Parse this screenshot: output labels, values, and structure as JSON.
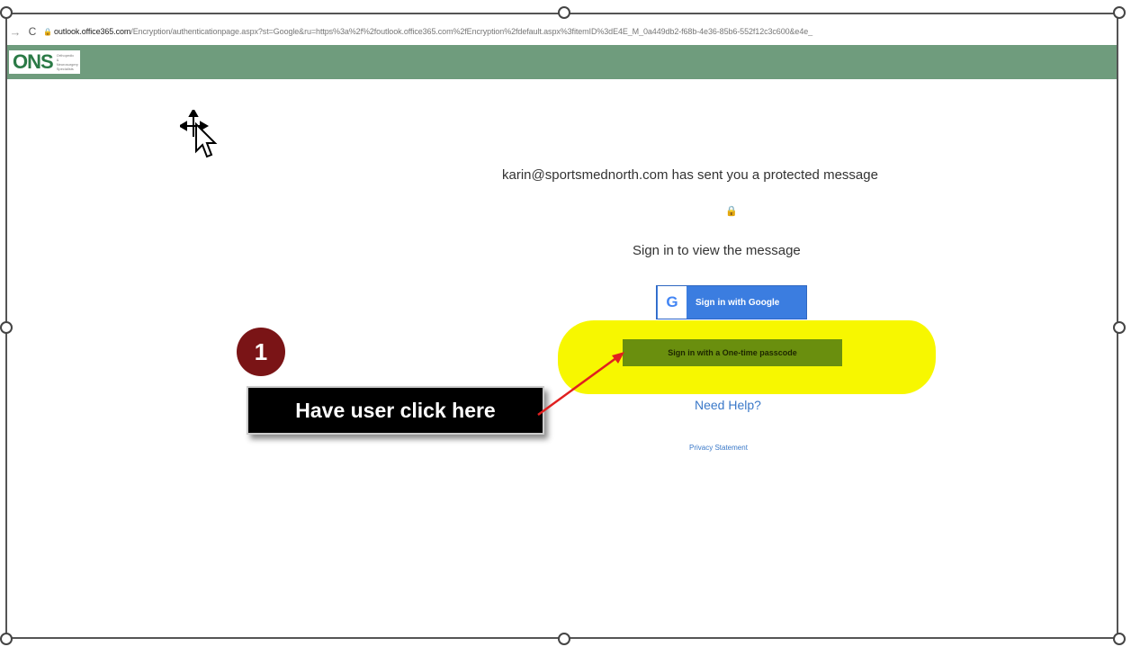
{
  "browser": {
    "url_host": "outlook.office365.com",
    "url_path": "/Encryption/authenticationpage.aspx?st=Google&ru=https%3a%2f%2foutlook.office365.com%2fEncryption%2fdefault.aspx%3fitemID%3dE4E_M_0a449db2-f68b-4e36-85b6-552f12c3c600&e4e_"
  },
  "brand": {
    "logo_text": "ONS",
    "logo_subtext": "Orthopedic & Neurosurgery Specialists",
    "header_color": "#6f9c7d"
  },
  "message": {
    "sender_line": "karin@sportsmednorth.com has sent you a protected message",
    "signin_prompt": "Sign in to view the message",
    "google_button": "Sign in with Google",
    "google_glyph": "G",
    "otp_button": "Sign in with a One-time passcode",
    "help_link": "Need Help?",
    "privacy_link": "Privacy Statement"
  },
  "annotation": {
    "step_number": "1",
    "callout_text": "Have user click here",
    "arrow_color": "#e02020",
    "highlight_color": "#f7f700"
  },
  "icons": {
    "lock": "lock-icon",
    "move_cursor": "move-cursor-icon"
  }
}
